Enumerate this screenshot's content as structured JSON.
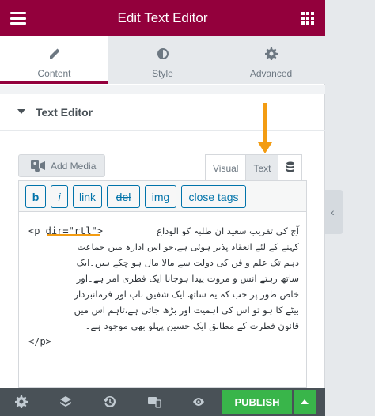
{
  "header": {
    "title": "Edit Text Editor",
    "menu_icon": "hamburger-icon",
    "grid_icon": "apps-grid-icon"
  },
  "tabs": [
    {
      "label": "Content",
      "icon": "pencil-icon",
      "active": true
    },
    {
      "label": "Style",
      "icon": "half-circle-icon",
      "active": false
    },
    {
      "label": "Advanced",
      "icon": "gear-icon",
      "active": false
    }
  ],
  "section": {
    "title": "Text Editor"
  },
  "editor": {
    "add_media": "Add Media",
    "mode_visual": "Visual",
    "mode_text": "Text",
    "toolbar": [
      "b",
      "i",
      "link",
      "del",
      "img",
      "close tags"
    ],
    "code_open": "<p dir=\"rtl\">",
    "code_lines": [
      "آج کی تقریب سعید ان طلبہ کو الوداع",
      "کہنے کے لئے انعقاد پذیر ہوئی ہے،جو اس ادارہ میں جماعت",
      "دہم تک علم و فن کی دولت سے مالا مال ہو چکے ہیں۔ایک",
      "ساتھ رہتے انس و مروت پیدا ہوجانا ایک فطری امر ہے۔اور",
      "خاص طور پر جب کہ یہ ساتھ ایک شفیق باپ اور فرمانبردار",
      "بیٹے کا ہو تو اس کی اہمیت اور بڑھ جاتی ہے،تاہم اس میں",
      "قانون فطرت کے مطابق ایک حسین پہلو بھی موجود ہے۔"
    ],
    "code_close": "</p>"
  },
  "footer": {
    "publish": "PUBLISH"
  },
  "colors": {
    "brand": "#93003c",
    "publish": "#39b54a",
    "annotation": "#f39c12",
    "footer_bg": "#495157"
  }
}
